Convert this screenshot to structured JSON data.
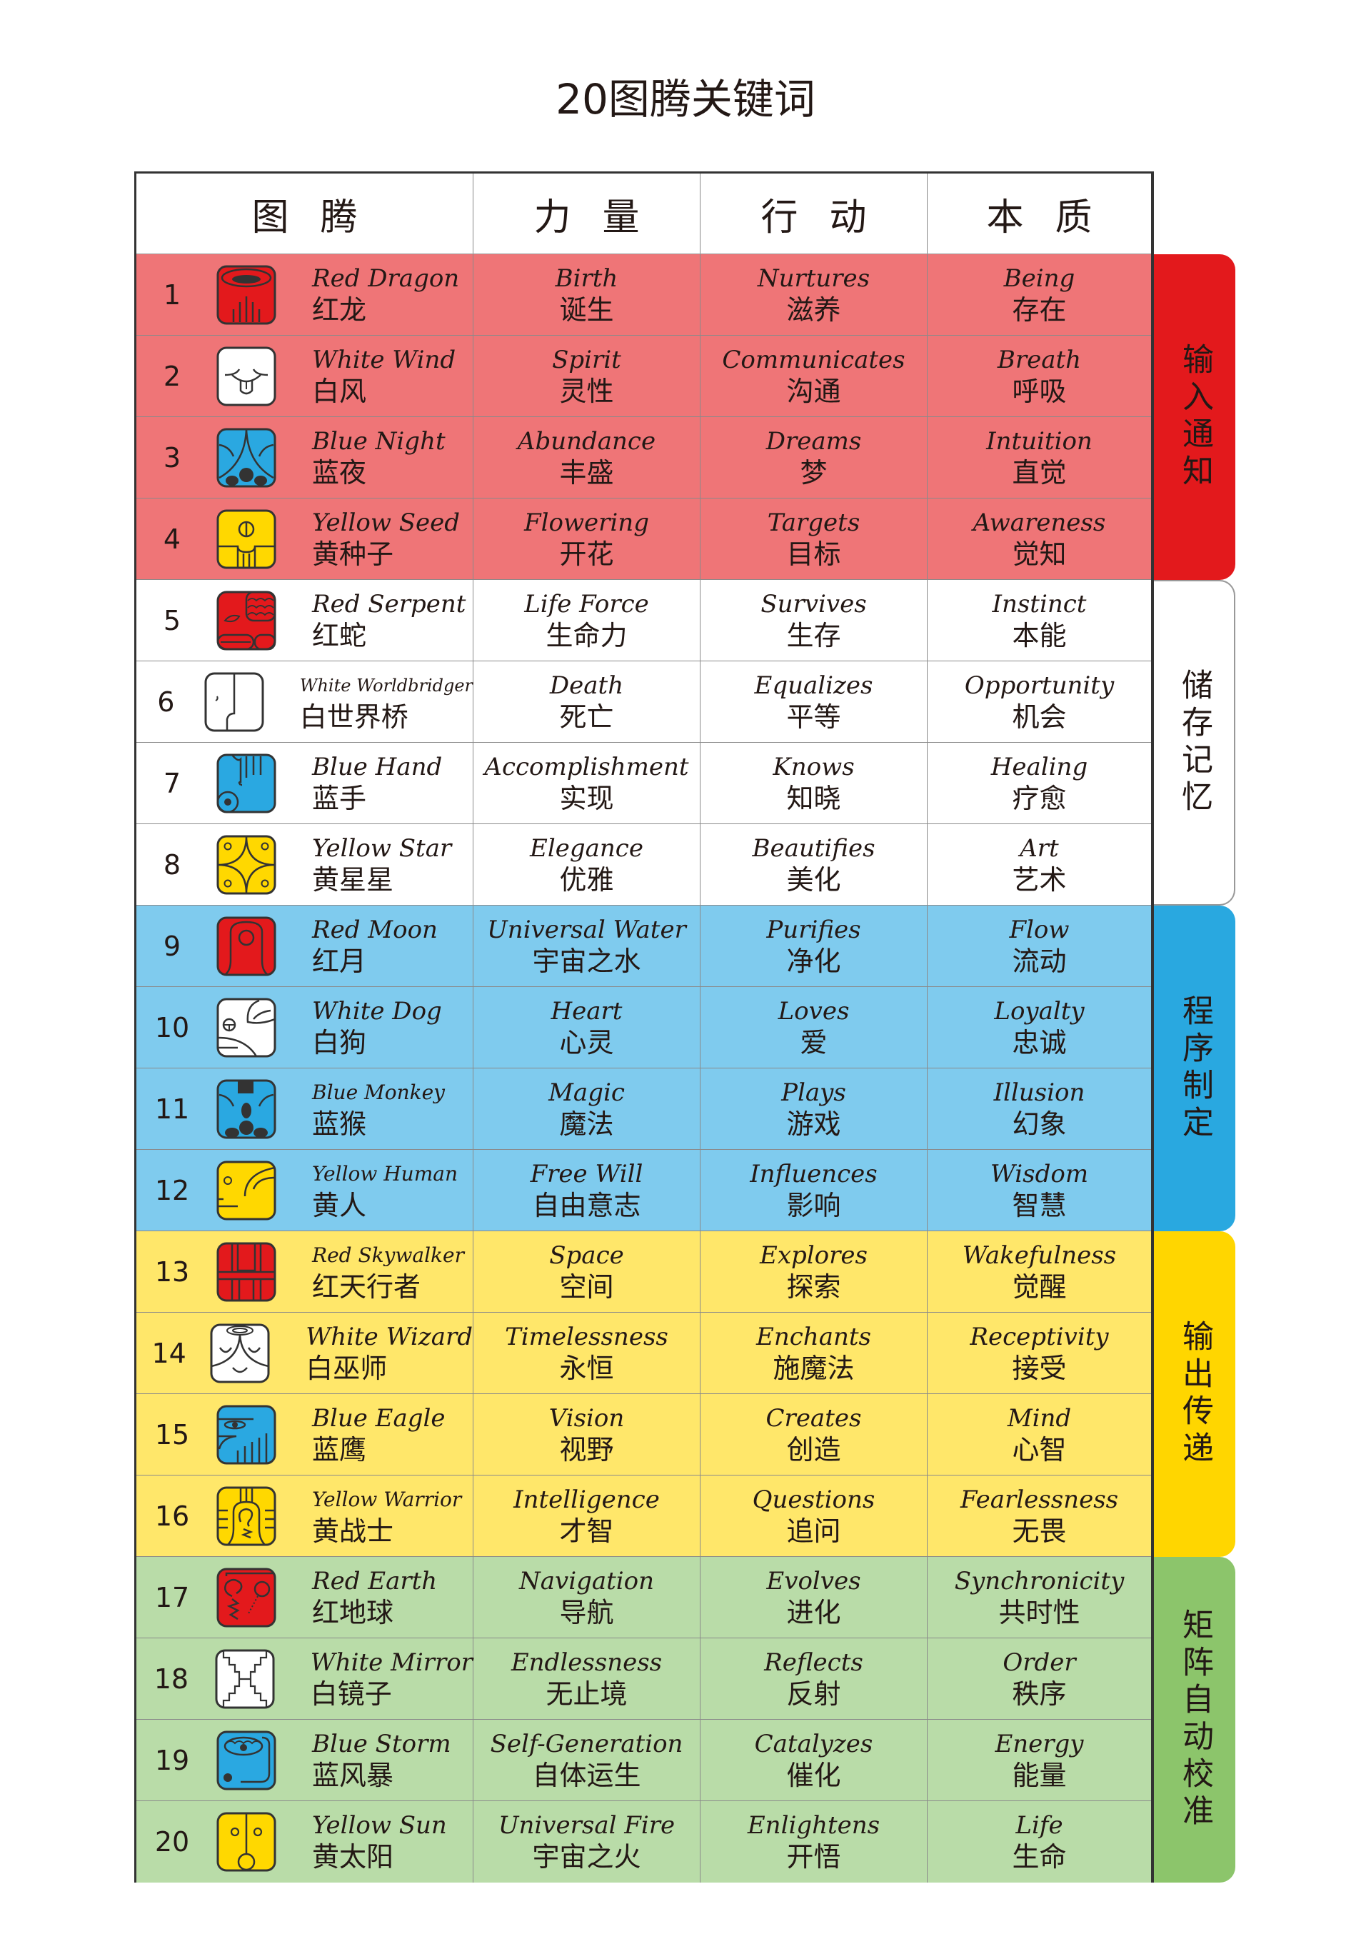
{
  "title": "20图腾关键词",
  "header": [
    "图腾",
    "力量",
    "行动",
    "本质"
  ],
  "colors": {
    "red_row": "#EF7577",
    "blue_row": "#7FCBEE",
    "yellow_row": "#FFE76A",
    "green_row": "#B9DCA8",
    "white_row": "#FFFFFF",
    "icon_red": "#E3191C",
    "icon_blue": "#2AA8E1",
    "icon_yellow": "#FFD800",
    "icon_white": "#FFFFFF",
    "band_red": "#E3191C",
    "band_blue": "#29A8E0",
    "band_yellow": "#FFD600",
    "band_green": "#8CC56B",
    "band_white": "#FFFFFF"
  },
  "groups": [
    {
      "label": "输入通知",
      "color_key": "band_red",
      "row_color_key": "red_row",
      "rows": [
        1,
        4
      ]
    },
    {
      "label": "储存记忆",
      "color_key": "band_white",
      "row_color_key": "white_row",
      "rows": [
        5,
        8
      ]
    },
    {
      "label": "程序制定",
      "color_key": "band_blue",
      "row_color_key": "blue_row",
      "rows": [
        9,
        12
      ]
    },
    {
      "label": "输出传递",
      "color_key": "band_yellow",
      "row_color_key": "yellow_row",
      "rows": [
        13,
        16
      ]
    },
    {
      "label": "矩阵自动校准",
      "color_key": "band_green",
      "row_color_key": "green_row",
      "rows": [
        17,
        20
      ]
    }
  ],
  "rows": [
    {
      "num": "1",
      "icon": "red-dragon-glyph",
      "name_en": "Red Dragon",
      "name_zh": "红龙",
      "power_en": "Birth",
      "power_zh": "诞生",
      "action_en": "Nurtures",
      "action_zh": "滋养",
      "essence_en": "Being",
      "essence_zh": "存在"
    },
    {
      "num": "2",
      "icon": "white-wind-glyph",
      "name_en": "White Wind",
      "name_zh": "白风",
      "power_en": "Spirit",
      "power_zh": "灵性",
      "action_en": "Communicates",
      "action_zh": "沟通",
      "essence_en": "Breath",
      "essence_zh": "呼吸"
    },
    {
      "num": "3",
      "icon": "blue-night-glyph",
      "name_en": "Blue Night",
      "name_zh": "蓝夜",
      "power_en": "Abundance",
      "power_zh": "丰盛",
      "action_en": "Dreams",
      "action_zh": "梦",
      "essence_en": "Intuition",
      "essence_zh": "直觉"
    },
    {
      "num": "4",
      "icon": "yellow-seed-glyph",
      "name_en": "Yellow Seed",
      "name_zh": "黄种子",
      "power_en": "Flowering",
      "power_zh": "开花",
      "action_en": "Targets",
      "action_zh": "目标",
      "essence_en": "Awareness",
      "essence_zh": "觉知"
    },
    {
      "num": "5",
      "icon": "red-serpent-glyph",
      "name_en": "Red Serpent",
      "name_zh": "红蛇",
      "power_en": "Life Force",
      "power_zh": "生命力",
      "action_en": "Survives",
      "action_zh": "生存",
      "essence_en": "Instinct",
      "essence_zh": "本能"
    },
    {
      "num": "6",
      "icon": "white-worldbridger-glyph",
      "name_en": "White Worldbridger",
      "name_zh": "白世界桥",
      "power_en": "Death",
      "power_zh": "死亡",
      "action_en": "Equalizes",
      "action_zh": "平等",
      "essence_en": "Opportunity",
      "essence_zh": "机会"
    },
    {
      "num": "7",
      "icon": "blue-hand-glyph",
      "name_en": "Blue Hand",
      "name_zh": "蓝手",
      "power_en": "Accomplishment",
      "power_zh": "实现",
      "action_en": "Knows",
      "action_zh": "知晓",
      "essence_en": "Healing",
      "essence_zh": "疗愈"
    },
    {
      "num": "8",
      "icon": "yellow-star-glyph",
      "name_en": "Yellow Star",
      "name_zh": "黄星星",
      "power_en": "Elegance",
      "power_zh": "优雅",
      "action_en": "Beautifies",
      "action_zh": "美化",
      "essence_en": "Art",
      "essence_zh": "艺术"
    },
    {
      "num": "9",
      "icon": "red-moon-glyph",
      "name_en": "Red Moon",
      "name_zh": "红月",
      "power_en": "Universal Water",
      "power_zh": "宇宙之水",
      "action_en": "Purifies",
      "action_zh": "净化",
      "essence_en": "Flow",
      "essence_zh": "流动"
    },
    {
      "num": "10",
      "icon": "white-dog-glyph",
      "name_en": "White Dog",
      "name_zh": "白狗",
      "power_en": "Heart",
      "power_zh": "心灵",
      "action_en": "Loves",
      "action_zh": "爱",
      "essence_en": "Loyalty",
      "essence_zh": "忠诚"
    },
    {
      "num": "11",
      "icon": "blue-monkey-glyph",
      "name_en": "Blue Monkey",
      "name_zh": "蓝猴",
      "power_en": "Magic",
      "power_zh": "魔法",
      "action_en": "Plays",
      "action_zh": "游戏",
      "essence_en": "Illusion",
      "essence_zh": "幻象"
    },
    {
      "num": "12",
      "icon": "yellow-human-glyph",
      "name_en": "Yellow Human",
      "name_zh": "黄人",
      "power_en": "Free Will",
      "power_zh": "自由意志",
      "action_en": "Influences",
      "action_zh": "影响",
      "essence_en": "Wisdom",
      "essence_zh": "智慧"
    },
    {
      "num": "13",
      "icon": "red-skywalker-glyph",
      "name_en": "Red Skywalker",
      "name_zh": "红天行者",
      "power_en": "Space",
      "power_zh": "空间",
      "action_en": "Explores",
      "action_zh": "探索",
      "essence_en": "Wakefulness",
      "essence_zh": "觉醒"
    },
    {
      "num": "14",
      "icon": "white-wizard-glyph",
      "name_en": "White Wizard",
      "name_zh": "白巫师",
      "power_en": "Timelessness",
      "power_zh": "永恒",
      "action_en": "Enchants",
      "action_zh": "施魔法",
      "essence_en": "Receptivity",
      "essence_zh": "接受"
    },
    {
      "num": "15",
      "icon": "blue-eagle-glyph",
      "name_en": "Blue Eagle",
      "name_zh": "蓝鹰",
      "power_en": "Vision",
      "power_zh": "视野",
      "action_en": "Creates",
      "action_zh": "创造",
      "essence_en": "Mind",
      "essence_zh": "心智"
    },
    {
      "num": "16",
      "icon": "yellow-warrior-glyph",
      "name_en": "Yellow Warrior",
      "name_zh": "黄战士",
      "power_en": "Intelligence",
      "power_zh": "才智",
      "action_en": "Questions",
      "action_zh": "追问",
      "essence_en": "Fearlessness",
      "essence_zh": "无畏"
    },
    {
      "num": "17",
      "icon": "red-earth-glyph",
      "name_en": "Red Earth",
      "name_zh": "红地球",
      "power_en": "Navigation",
      "power_zh": "导航",
      "action_en": "Evolves",
      "action_zh": "进化",
      "essence_en": "Synchronicity",
      "essence_zh": "共时性"
    },
    {
      "num": "18",
      "icon": "white-mirror-glyph",
      "name_en": "White Mirror",
      "name_zh": "白镜子",
      "power_en": "Endlessness",
      "power_zh": "无止境",
      "action_en": "Reflects",
      "action_zh": "反射",
      "essence_en": "Order",
      "essence_zh": "秩序"
    },
    {
      "num": "19",
      "icon": "blue-storm-glyph",
      "name_en": "Blue Storm",
      "name_zh": "蓝风暴",
      "power_en": "Self-Generation",
      "power_zh": "自体运生",
      "action_en": "Catalyzes",
      "action_zh": "催化",
      "essence_en": "Energy",
      "essence_zh": "能量"
    },
    {
      "num": "20",
      "icon": "yellow-sun-glyph",
      "name_en": "Yellow Sun",
      "name_zh": "黄太阳",
      "power_en": "Universal Fire",
      "power_zh": "宇宙之火",
      "action_en": "Enlightens",
      "action_zh": "开悟",
      "essence_en": "Life",
      "essence_zh": "生命"
    }
  ]
}
